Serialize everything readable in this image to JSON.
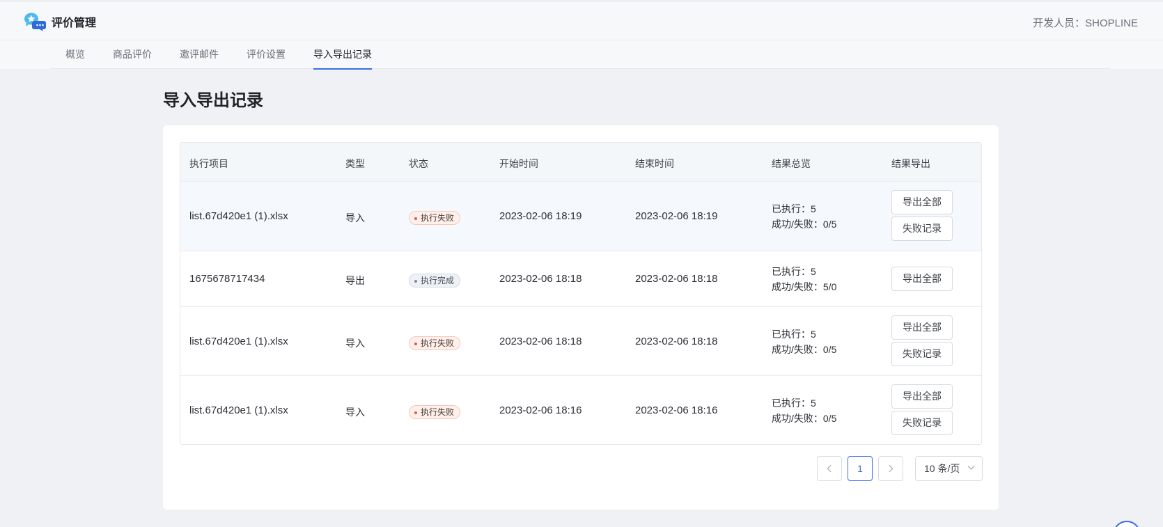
{
  "app": {
    "title": "评价管理",
    "developer": "开发人员：SHOPLINE",
    "accent_color": "#3b6ce3",
    "logo_icon": "chat-bubbles-star-icon"
  },
  "tabs": [
    {
      "label": "概览",
      "active": false
    },
    {
      "label": "商品评价",
      "active": false
    },
    {
      "label": "邀评邮件",
      "active": false
    },
    {
      "label": "评价设置",
      "active": false
    },
    {
      "label": "导入导出记录",
      "active": true
    }
  ],
  "page_title": "导入导出记录",
  "table": {
    "columns": [
      "执行项目",
      "类型",
      "状态",
      "开始时间",
      "结束时间",
      "结果总览",
      "结果导出"
    ],
    "rows": [
      {
        "name": "list.67d420e1 (1).xlsx",
        "type": "导入",
        "status": "执行失败",
        "status_kind": "fail",
        "start": "2023-02-06 18:19",
        "end": "2023-02-06 18:19",
        "executed": "已执行：5",
        "result": "成功/失败：0/5",
        "actions": [
          "导出全部",
          "失败记录"
        ]
      },
      {
        "name": "1675678717434",
        "type": "导出",
        "status": "执行完成",
        "status_kind": "done",
        "start": "2023-02-06 18:18",
        "end": "2023-02-06 18:18",
        "executed": "已执行：5",
        "result": "成功/失败：5/0",
        "actions": [
          "导出全部"
        ]
      },
      {
        "name": "list.67d420e1 (1).xlsx",
        "type": "导入",
        "status": "执行失败",
        "status_kind": "fail",
        "start": "2023-02-06 18:18",
        "end": "2023-02-06 18:18",
        "executed": "已执行：5",
        "result": "成功/失败：0/5",
        "actions": [
          "导出全部",
          "失败记录"
        ]
      },
      {
        "name": "list.67d420e1 (1).xlsx",
        "type": "导入",
        "status": "执行失败",
        "status_kind": "fail",
        "start": "2023-02-06 18:16",
        "end": "2023-02-06 18:16",
        "executed": "已执行：5",
        "result": "成功/失败：0/5",
        "actions": [
          "导出全部",
          "失败记录"
        ]
      }
    ]
  },
  "pagination": {
    "prev_icon": "chevron-left-icon",
    "current_page": "1",
    "next_icon": "chevron-right-icon",
    "page_size": "10 条/页",
    "page_size_icon": "chevron-down-icon"
  }
}
